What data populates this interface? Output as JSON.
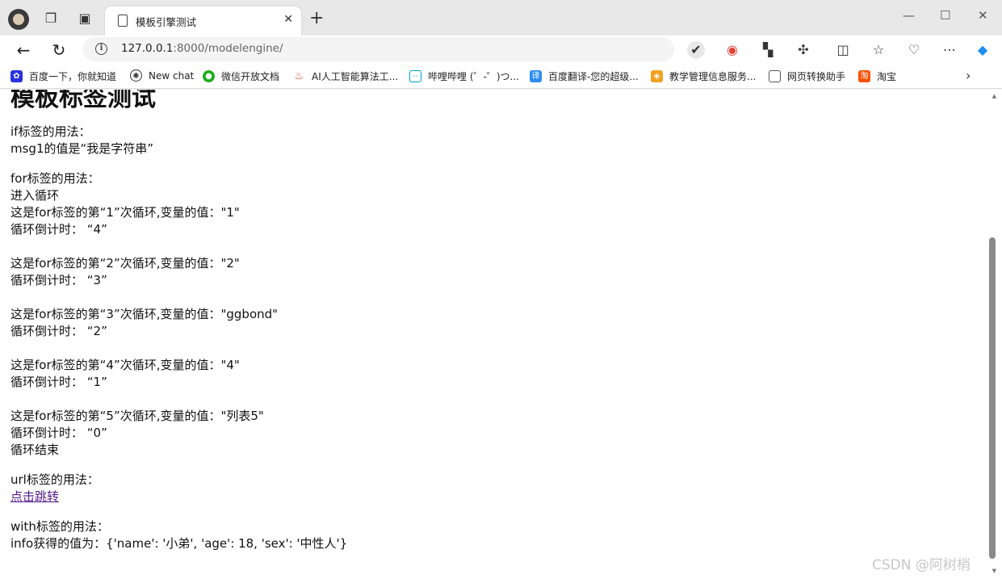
{
  "browser": {
    "tab_title": "模板引擎测试",
    "url_host": "127.0.0.1",
    "url_path": ":8000/modelengine/"
  },
  "bookmarks": [
    {
      "label": "百度一下，你就知道",
      "icon": "paw-icon",
      "color": "#2932e1"
    },
    {
      "label": "New chat",
      "icon": "openai-icon",
      "color": "#333333"
    },
    {
      "label": "微信开放文档",
      "icon": "wechat-icon",
      "color": "#1aad19"
    },
    {
      "label": "AI人工智能算法工...",
      "icon": "flame-icon",
      "color": "#e8452c"
    },
    {
      "label": "哔哩哔哩 (゜-゜)つ...",
      "icon": "bilibili-icon",
      "color": "#00a1d6"
    },
    {
      "label": "百度翻译-您的超级...",
      "icon": "translate-icon",
      "color": "#2d8cf0"
    },
    {
      "label": "教学管理信息服务...",
      "icon": "stack-icon",
      "color": "#3a7bd5"
    },
    {
      "label": "网页转换助手",
      "icon": "doc-icon",
      "color": "#555555"
    },
    {
      "label": "淘宝",
      "icon": "taobao-icon",
      "color": "#ff5000"
    }
  ],
  "page": {
    "heading": "模板标签测试",
    "if_section": {
      "title": "if标签的用法：",
      "line": "msg1的值是“我是字符串”"
    },
    "for_section": {
      "title": "for标签的用法：",
      "enter": "进入循环",
      "iterations": [
        {
          "text": "这是for标签的第“1”次循环,变量的值：\"1\"",
          "countdown": "循环倒计时： “4”"
        },
        {
          "text": "这是for标签的第“2”次循环,变量的值：\"2\"",
          "countdown": "循环倒计时： “3”"
        },
        {
          "text": "这是for标签的第“3”次循环,变量的值：\"ggbond\"",
          "countdown": "循环倒计时： “2”"
        },
        {
          "text": "这是for标签的第“4”次循环,变量的值：\"4\"",
          "countdown": "循环倒计时： “1”"
        },
        {
          "text": "这是for标签的第“5”次循环,变量的值：\"列表5\"",
          "countdown": "循环倒计时： “0”"
        }
      ],
      "end": "循环结束"
    },
    "url_section": {
      "title": "url标签的用法：",
      "link": "点击跳转"
    },
    "with_section": {
      "title": "with标签的用法：",
      "line": "info获得的值为：{'name': '小弟', 'age': 18, 'sex': '中性人'}"
    }
  },
  "watermark": "CSDN @阿树梢"
}
